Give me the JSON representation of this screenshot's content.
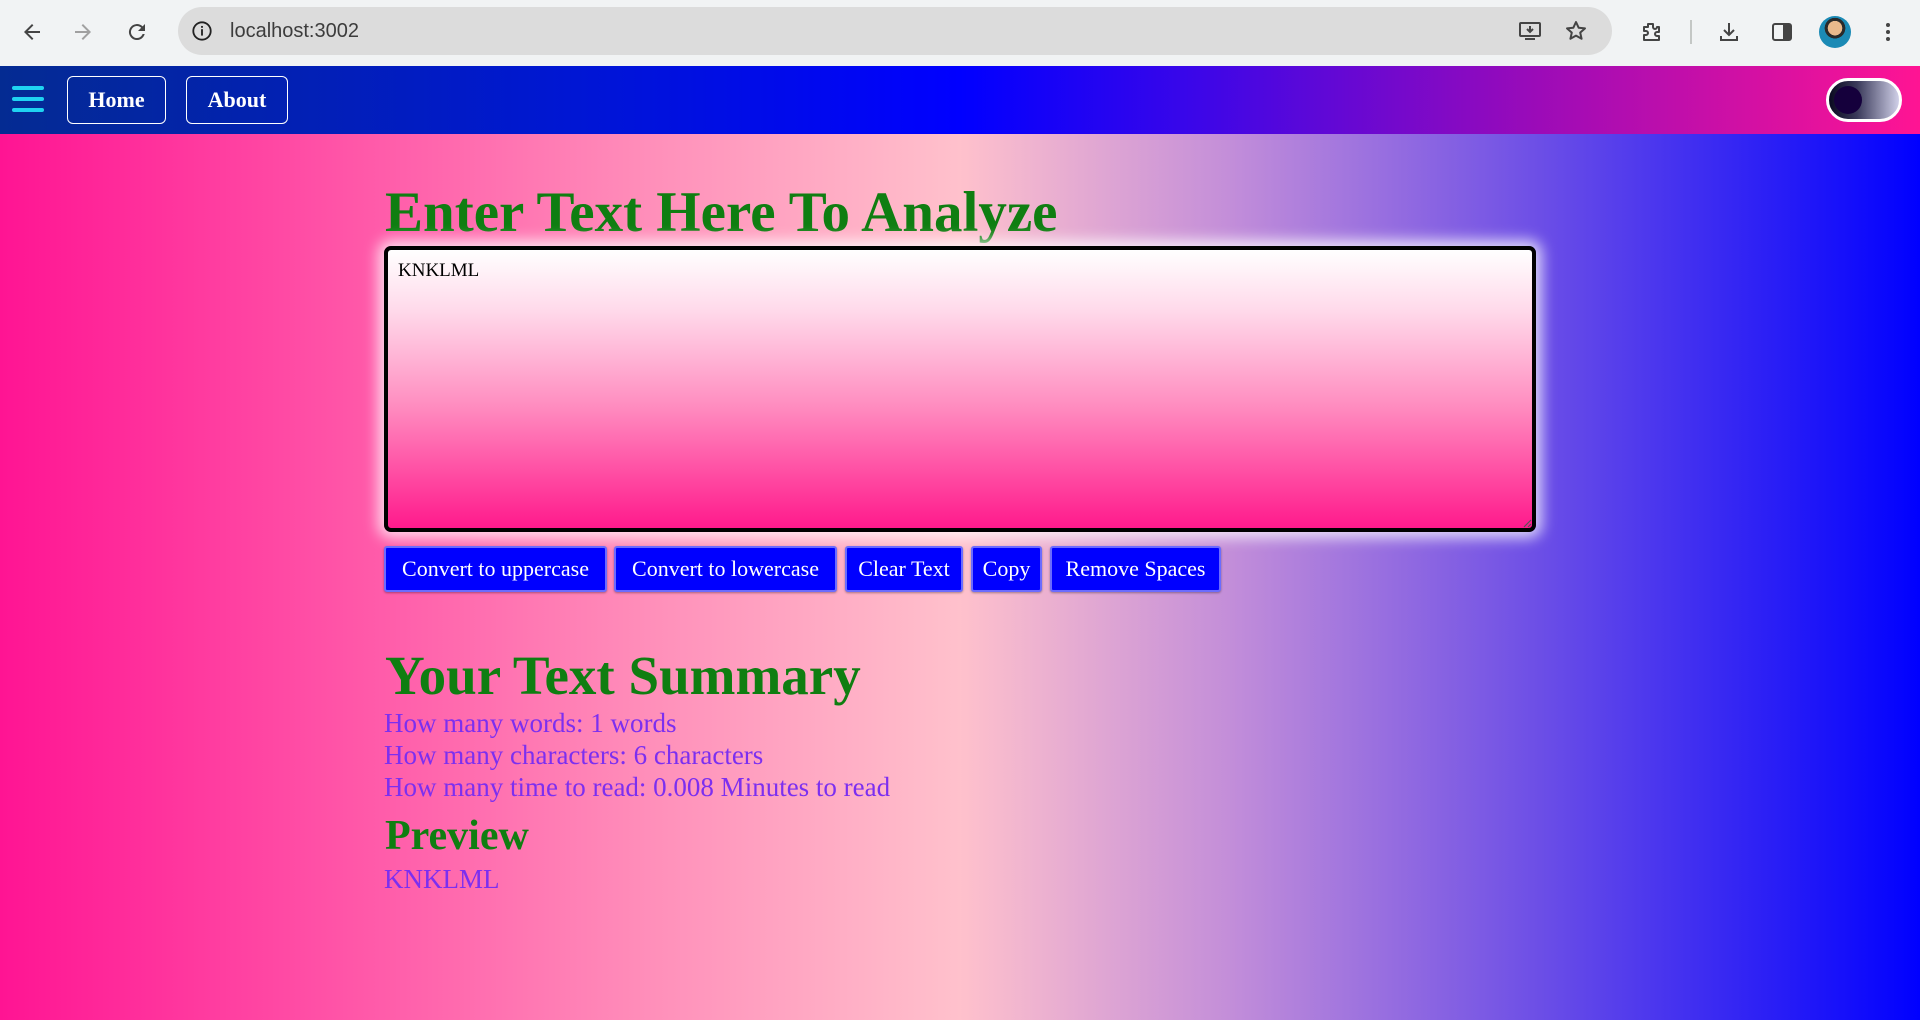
{
  "browser": {
    "url": "localhost:3002"
  },
  "navbar": {
    "links": [
      {
        "label": "Home"
      },
      {
        "label": "About"
      }
    ],
    "dark_mode_toggle_on": false
  },
  "form": {
    "heading": "Enter Text Here To Analyze",
    "textarea_value": "KNKLML",
    "buttons": [
      {
        "label": "Convert to uppercase"
      },
      {
        "label": "Convert to lowercase"
      },
      {
        "label": "Clear Text"
      },
      {
        "label": "Copy"
      },
      {
        "label": "Remove Spaces"
      }
    ]
  },
  "summary": {
    "heading": "Your Text Summary",
    "words_line": "How many words: 1 words",
    "characters_line": "How many characters: 6 characters",
    "read_time_line": "How many time to read: 0.008 Minutes to read"
  },
  "preview": {
    "heading": "Preview",
    "text": "KNKLML"
  },
  "colors": {
    "heading_green": "#0f7e11",
    "stat_purple": "#7c2ff0",
    "button_blue": "#0000ff"
  }
}
